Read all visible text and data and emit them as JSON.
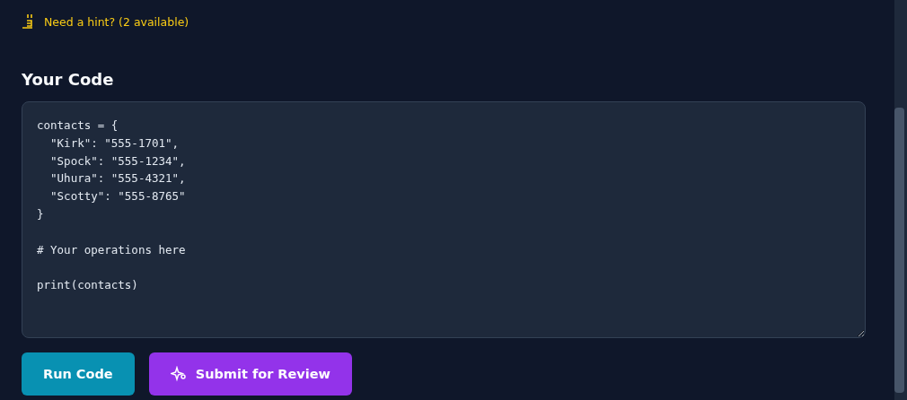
{
  "hint": {
    "label": "Need a hint? (2 available)"
  },
  "editor": {
    "title": "Your Code",
    "value": "contacts = {\n  \"Kirk\": \"555-1701\",\n  \"Spock\": \"555-1234\",\n  \"Uhura\": \"555-4321\",\n  \"Scotty\": \"555-8765\"\n}\n\n# Your operations here\n\nprint(contacts)"
  },
  "buttons": [
    {
      "label": "Run Code",
      "kind": "run"
    },
    {
      "label": "Submit for Review",
      "kind": "submit"
    }
  ]
}
